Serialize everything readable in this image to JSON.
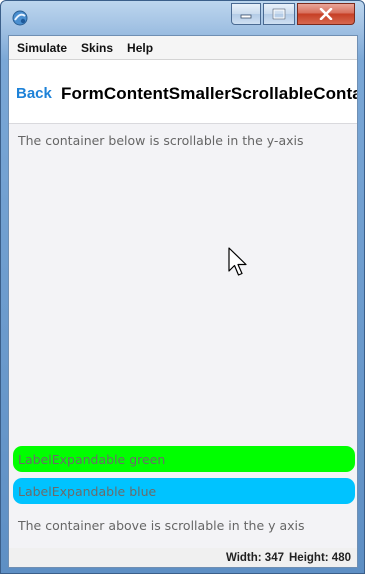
{
  "window": {
    "buttons": [
      "minimize",
      "maximize",
      "close"
    ]
  },
  "menubar": {
    "items": [
      "Simulate",
      "Skins",
      "Help"
    ]
  },
  "form": {
    "back_label": "Back",
    "title": "FormContentSmallerScrollableContainer",
    "label_top": "The container below is scrollable in the y-axis",
    "label_green": "LabelExpandable green",
    "label_blue": "LabelExpandable blue",
    "label_bottom": "The container above is scrollable in the y axis"
  },
  "status": {
    "width_text": "Width: 347",
    "height_text": "Height: 480"
  },
  "colors": {
    "green_pill": "#00ff00",
    "blue_pill": "#00c3ff",
    "back_link": "#1e82d8"
  },
  "icons": {
    "app": "app-icon",
    "cursor": "mouse-pointer-icon"
  }
}
